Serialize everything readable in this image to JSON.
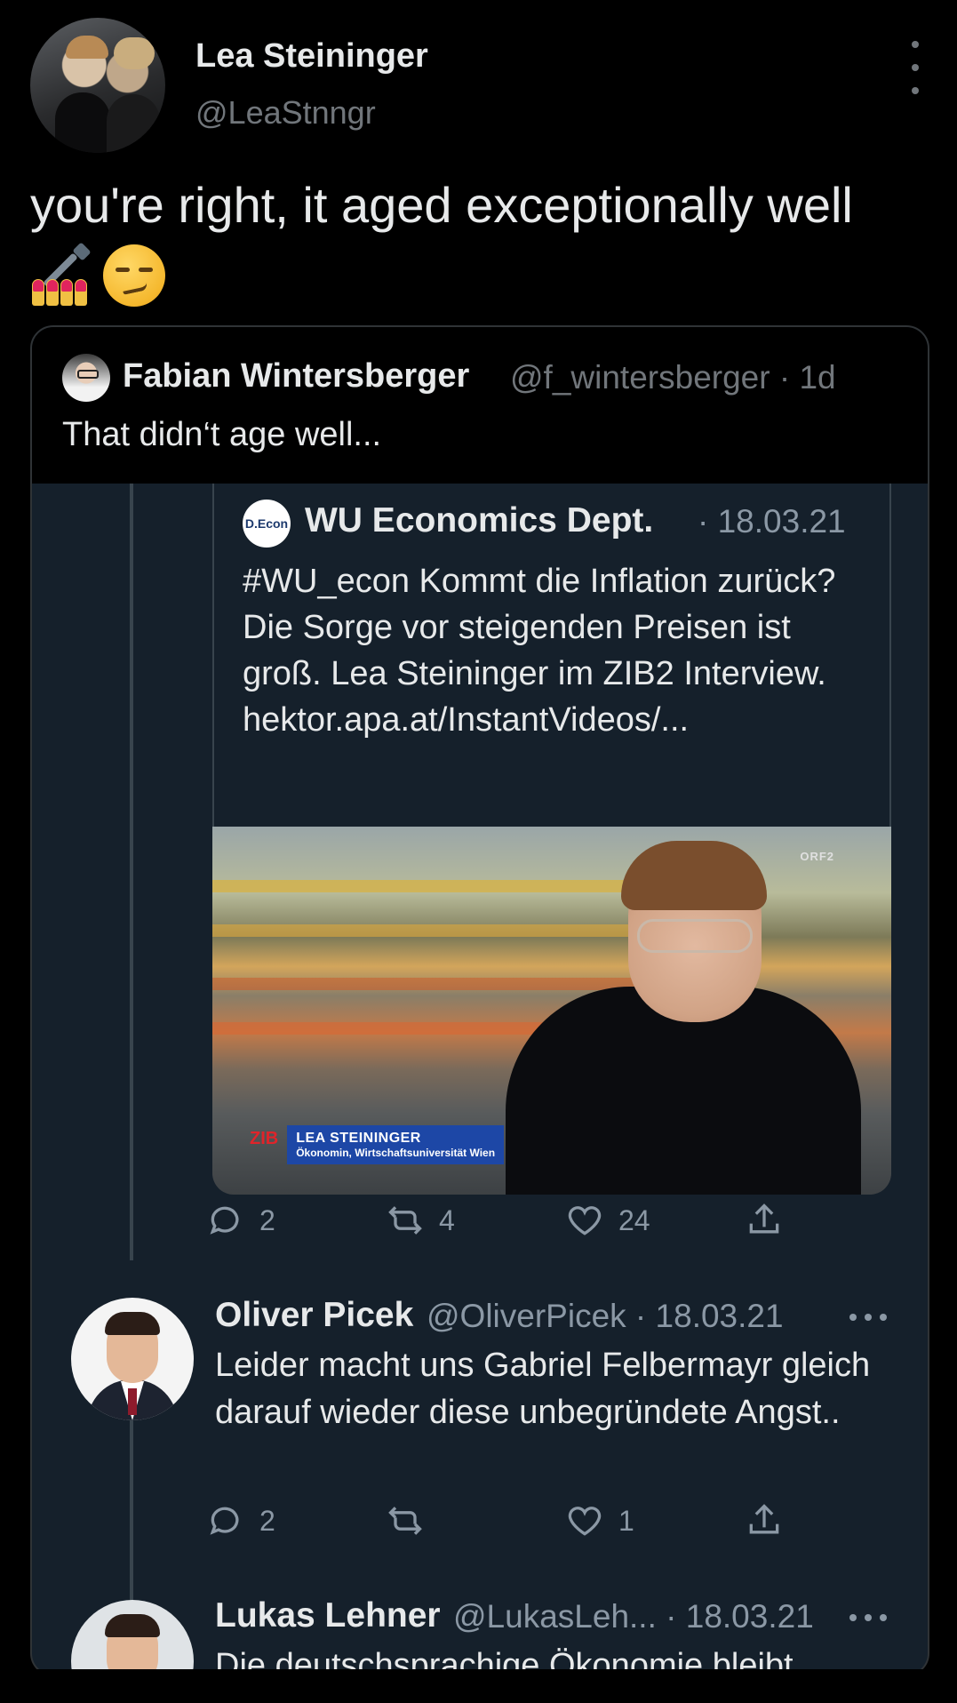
{
  "author": {
    "name": "Lea Steininger",
    "handle": "@LeaStnngr"
  },
  "tweet": {
    "text": "you're right, it aged exceptionally well",
    "emojis": [
      "nail-polish",
      "smirking-face"
    ]
  },
  "quoted": {
    "name": "Fabian Wintersberger",
    "meta": "@f_wintersberger · 1d",
    "text": "That didn‘t age well..."
  },
  "inner_quote": {
    "name": "WU Economics Dept.",
    "date": "· 18.03.21",
    "avatar_text": "D.Econ",
    "text": "#WU_econ Kommt die Inflation zurück? Die Sorge vor steigenden Preisen ist groß. Lea Steininger im ZIB2 Interview. hektor.apa.at/InstantVideos/...",
    "video": {
      "channel_logo": "ORF2",
      "tag": "ZIB",
      "person": "LEA STEININGER",
      "role": "Ökonomin, Wirtschaftsuniversität Wien"
    },
    "stats": {
      "replies": "2",
      "retweets": "4",
      "likes": "24"
    }
  },
  "replies": [
    {
      "name": "Oliver Picek",
      "meta": "@OliverPicek · 18.03.21",
      "text": "Leider macht uns Gabriel Felbermayr gleich darauf wieder diese unbegründete Angst..",
      "stats": {
        "replies": "2",
        "retweets": "",
        "likes": "1"
      }
    },
    {
      "name": "Lukas Lehner",
      "meta": "@LukasLeh... · 18.03.21",
      "text": "Die deutschsprachige Ökonomie bleibt"
    }
  ],
  "colors": {
    "background": "#000000",
    "card": "#15202b",
    "text": "#e7e9ea",
    "muted": "#8b98a5",
    "zib_blue": "#1d47a6",
    "zib_red": "#e0242a"
  }
}
